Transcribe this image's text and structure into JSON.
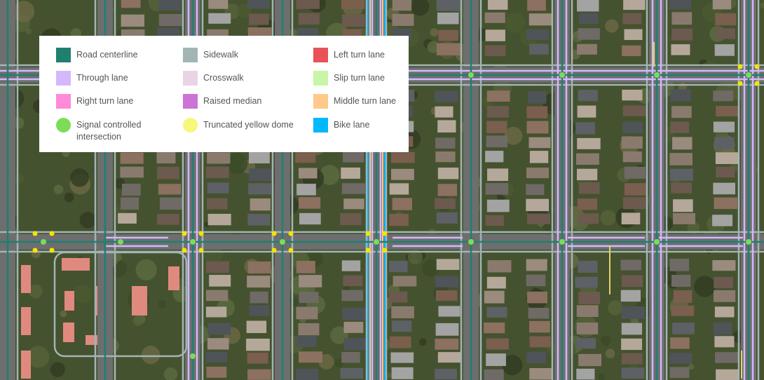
{
  "map": {
    "type": "aerial-road-annotation",
    "colors": {
      "road_centerline": "#1f8070",
      "through_lane": "#d4b8fc",
      "right_turn_lane": "#ff8ad8",
      "signal_controlled_intersection": "#7ddb5a",
      "sidewalk": "#a2b5b5",
      "crosswalk": "#e8d4e2",
      "raised_median": "#cc74d6",
      "truncated_yellow_dome": "#f7f77a",
      "left_turn_lane": "#e85258",
      "slip_turn_lane": "#c9f5a6",
      "middle_turn_lane": "#ffc98a",
      "bike_lane": "#00b8ff"
    }
  },
  "legend": {
    "items": [
      {
        "label": "Road centerline",
        "color": "#1f8070",
        "shape": "square"
      },
      {
        "label": "Through lane",
        "color": "#d4b8fc",
        "shape": "square"
      },
      {
        "label": "Right turn lane",
        "color": "#ff8ad8",
        "shape": "square"
      },
      {
        "label": "Signal controlled intersection",
        "color": "#7ddb5a",
        "shape": "circle"
      },
      {
        "label": "Sidewalk",
        "color": "#a2b5b5",
        "shape": "square"
      },
      {
        "label": "Crosswalk",
        "color": "#e8d4e2",
        "shape": "square"
      },
      {
        "label": "Raised median",
        "color": "#cc74d6",
        "shape": "square"
      },
      {
        "label": "Truncated yellow dome",
        "color": "#f7f77a",
        "shape": "circle"
      },
      {
        "label": "Left turn lane",
        "color": "#e85258",
        "shape": "square"
      },
      {
        "label": "Slip turn lane",
        "color": "#c9f5a6",
        "shape": "square"
      },
      {
        "label": "Middle turn lane",
        "color": "#ffc98a",
        "shape": "square"
      },
      {
        "label": "Bike lane",
        "color": "#00b8ff",
        "shape": "square"
      }
    ]
  }
}
